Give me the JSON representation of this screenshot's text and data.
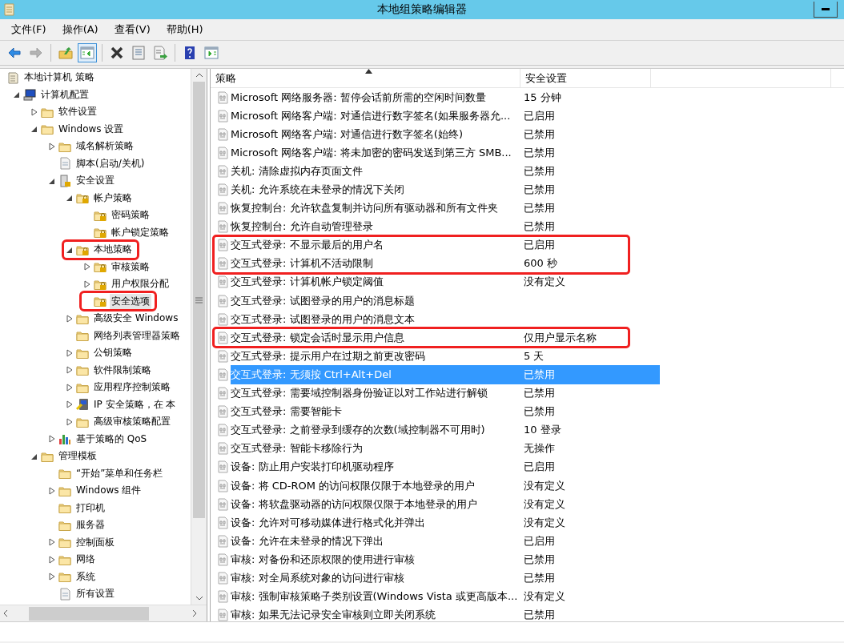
{
  "window": {
    "title": "本地组策略编辑器"
  },
  "menu": [
    "文件(F)",
    "操作(A)",
    "查看(V)",
    "帮助(H)"
  ],
  "toolbar": [
    {
      "kind": "back",
      "disabled": false
    },
    {
      "kind": "forward",
      "disabled": true
    },
    {
      "kind": "sep"
    },
    {
      "kind": "up",
      "disabled": false
    },
    {
      "kind": "tree",
      "disabled": false,
      "pressed": true
    },
    {
      "kind": "sep"
    },
    {
      "kind": "delete",
      "disabled": false
    },
    {
      "kind": "properties",
      "disabled": false
    },
    {
      "kind": "export",
      "disabled": false
    },
    {
      "kind": "sep"
    },
    {
      "kind": "help",
      "disabled": false
    },
    {
      "kind": "pane",
      "disabled": false
    }
  ],
  "tree": [
    {
      "label": "本地计算机 策略",
      "kind": "doc",
      "selected": false,
      "marked": false,
      "children": [
        {
          "label": "计算机配置",
          "kind": "computer",
          "expanded": true,
          "selected": false,
          "marked": false,
          "children": [
            {
              "label": "软件设置",
              "kind": "folder",
              "expanded": false,
              "selected": false,
              "marked": false
            },
            {
              "label": "Windows 设置",
              "kind": "folder",
              "expanded": true,
              "selected": false,
              "marked": false,
              "children": [
                {
                  "label": "域名解析策略",
                  "kind": "folder",
                  "expanded": false,
                  "selected": false,
                  "marked": false
                },
                {
                  "label": "脚本(启动/关机)",
                  "kind": "script",
                  "selected": false,
                  "marked": false
                },
                {
                  "label": "安全设置",
                  "kind": "security",
                  "expanded": true,
                  "selected": false,
                  "marked": false,
                  "children": [
                    {
                      "label": "帐户策略",
                      "kind": "lockfolder",
                      "expanded": true,
                      "selected": false,
                      "marked": false,
                      "children": [
                        {
                          "label": "密码策略",
                          "kind": "lockfolder",
                          "selected": false,
                          "marked": false
                        },
                        {
                          "label": "帐户锁定策略",
                          "kind": "lockfolder",
                          "selected": false,
                          "marked": false
                        }
                      ]
                    },
                    {
                      "label": "本地策略",
                      "kind": "lockfolder",
                      "expanded": true,
                      "selected": false,
                      "marked": true,
                      "children": [
                        {
                          "label": "审核策略",
                          "kind": "lockfolder",
                          "expanded": false,
                          "selected": false,
                          "marked": false
                        },
                        {
                          "label": "用户权限分配",
                          "kind": "lockfolder",
                          "expanded": false,
                          "selected": false,
                          "marked": false
                        },
                        {
                          "label": "安全选项",
                          "kind": "lockfolder",
                          "selected": true,
                          "marked": true
                        }
                      ]
                    },
                    {
                      "label": "高级安全 Windows",
                      "kind": "folder",
                      "expanded": false,
                      "selected": false,
                      "marked": false
                    },
                    {
                      "label": "网络列表管理器策略",
                      "kind": "folder",
                      "selected": false,
                      "marked": false
                    },
                    {
                      "label": "公钥策略",
                      "kind": "folder",
                      "expanded": false,
                      "selected": false,
                      "marked": false
                    },
                    {
                      "label": "软件限制策略",
                      "kind": "folder",
                      "expanded": false,
                      "selected": false,
                      "marked": false
                    },
                    {
                      "label": "应用程序控制策略",
                      "kind": "folder",
                      "expanded": false,
                      "selected": false,
                      "marked": false
                    },
                    {
                      "label": "IP 安全策略，在 本",
                      "kind": "ip",
                      "expanded": false,
                      "selected": false,
                      "marked": false
                    },
                    {
                      "label": "高级审核策略配置",
                      "kind": "folder",
                      "expanded": false,
                      "selected": false,
                      "marked": false
                    }
                  ]
                },
                {
                  "label": "基于策略的 QoS",
                  "kind": "chart",
                  "expanded": false,
                  "selected": false,
                  "marked": false
                }
              ]
            },
            {
              "label": "管理模板",
              "kind": "folder",
              "expanded": true,
              "selected": false,
              "marked": false,
              "children": [
                {
                  "label": "“开始”菜单和任务栏",
                  "kind": "folder",
                  "selected": false,
                  "marked": false
                },
                {
                  "label": "Windows 组件",
                  "kind": "folder",
                  "expanded": false,
                  "selected": false,
                  "marked": false
                },
                {
                  "label": "打印机",
                  "kind": "folder",
                  "selected": false,
                  "marked": false
                },
                {
                  "label": "服务器",
                  "kind": "folder",
                  "selected": false,
                  "marked": false
                },
                {
                  "label": "控制面板",
                  "kind": "folder",
                  "expanded": false,
                  "selected": false,
                  "marked": false
                },
                {
                  "label": "网络",
                  "kind": "folder",
                  "expanded": false,
                  "selected": false,
                  "marked": false
                },
                {
                  "label": "系统",
                  "kind": "folder",
                  "expanded": false,
                  "selected": false,
                  "marked": false
                },
                {
                  "label": "所有设置",
                  "kind": "script",
                  "selected": false,
                  "marked": false
                }
              ]
            }
          ]
        }
      ]
    }
  ],
  "table": {
    "columns": [
      {
        "label": "策略",
        "sorted": true
      },
      {
        "label": "安全设置",
        "sorted": false
      }
    ],
    "rows": [
      {
        "policy": "Microsoft 网络服务器: 暂停会话前所需的空闲时间数量",
        "setting": "15 分钟",
        "selected": false,
        "marked": false
      },
      {
        "policy": "Microsoft 网络客户端: 对通信进行数字签名(如果服务器允...",
        "setting": "已启用",
        "selected": false,
        "marked": false
      },
      {
        "policy": "Microsoft 网络客户端: 对通信进行数字签名(始终)",
        "setting": "已禁用",
        "selected": false,
        "marked": false
      },
      {
        "policy": "Microsoft 网络客户端: 将未加密的密码发送到第三方 SMB...",
        "setting": "已禁用",
        "selected": false,
        "marked": false
      },
      {
        "policy": "关机: 清除虚拟内存页面文件",
        "setting": "已禁用",
        "selected": false,
        "marked": false
      },
      {
        "policy": "关机: 允许系统在未登录的情况下关闭",
        "setting": "已禁用",
        "selected": false,
        "marked": false
      },
      {
        "policy": "恢复控制台: 允许软盘复制并访问所有驱动器和所有文件夹",
        "setting": "已禁用",
        "selected": false,
        "marked": false
      },
      {
        "policy": "恢复控制台: 允许自动管理登录",
        "setting": "已禁用",
        "selected": false,
        "marked": false
      },
      {
        "policy": "交互式登录: 不显示最后的用户名",
        "setting": "已启用",
        "selected": false,
        "marked": true
      },
      {
        "policy": "交互式登录: 计算机不活动限制",
        "setting": "600 秒",
        "selected": false,
        "marked": true
      },
      {
        "policy": "交互式登录: 计算机帐户锁定阈值",
        "setting": "没有定义",
        "selected": false,
        "marked": false
      },
      {
        "policy": "交互式登录: 试图登录的用户的消息标题",
        "selected": false,
        "marked": false
      },
      {
        "policy": "交互式登录: 试图登录的用户的消息文本",
        "selected": false,
        "marked": false
      },
      {
        "policy": "交互式登录: 锁定会话时显示用户信息",
        "setting": "仅用户显示名称",
        "selected": false,
        "marked": true
      },
      {
        "policy": "交互式登录: 提示用户在过期之前更改密码",
        "setting": "5 天",
        "selected": false,
        "marked": false
      },
      {
        "policy": "交互式登录: 无须按 Ctrl+Alt+Del",
        "setting": "已禁用",
        "selected": true,
        "marked": false
      },
      {
        "policy": "交互式登录: 需要域控制器身份验证以对工作站进行解锁",
        "setting": "已禁用",
        "selected": false,
        "marked": false
      },
      {
        "policy": "交互式登录: 需要智能卡",
        "setting": "已禁用",
        "selected": false,
        "marked": false
      },
      {
        "policy": "交互式登录: 之前登录到缓存的次数(域控制器不可用时)",
        "setting": "10 登录",
        "selected": false,
        "marked": false
      },
      {
        "policy": "交互式登录: 智能卡移除行为",
        "setting": "无操作",
        "selected": false,
        "marked": false
      },
      {
        "policy": "设备: 防止用户安装打印机驱动程序",
        "setting": "已启用",
        "selected": false,
        "marked": false
      },
      {
        "policy": "设备: 将 CD-ROM 的访问权限仅限于本地登录的用户",
        "setting": "没有定义",
        "selected": false,
        "marked": false
      },
      {
        "policy": "设备: 将软盘驱动器的访问权限仅限于本地登录的用户",
        "setting": "没有定义",
        "selected": false,
        "marked": false
      },
      {
        "policy": "设备: 允许对可移动媒体进行格式化并弹出",
        "setting": "没有定义",
        "selected": false,
        "marked": false
      },
      {
        "policy": "设备: 允许在未登录的情况下弹出",
        "setting": "已启用",
        "selected": false,
        "marked": false
      },
      {
        "policy": "审核: 对备份和还原权限的使用进行审核",
        "setting": "已禁用",
        "selected": false,
        "marked": false
      },
      {
        "policy": "审核: 对全局系统对象的访问进行审核",
        "setting": "已禁用",
        "selected": false,
        "marked": false
      },
      {
        "policy": "审核: 强制审核策略子类别设置(Windows Vista 或更高版本...",
        "setting": "没有定义",
        "selected": false,
        "marked": false
      },
      {
        "policy": "审核: 如果无法记录安全审核则立即关闭系统",
        "setting": "已禁用",
        "selected": false,
        "marked": false
      }
    ]
  }
}
